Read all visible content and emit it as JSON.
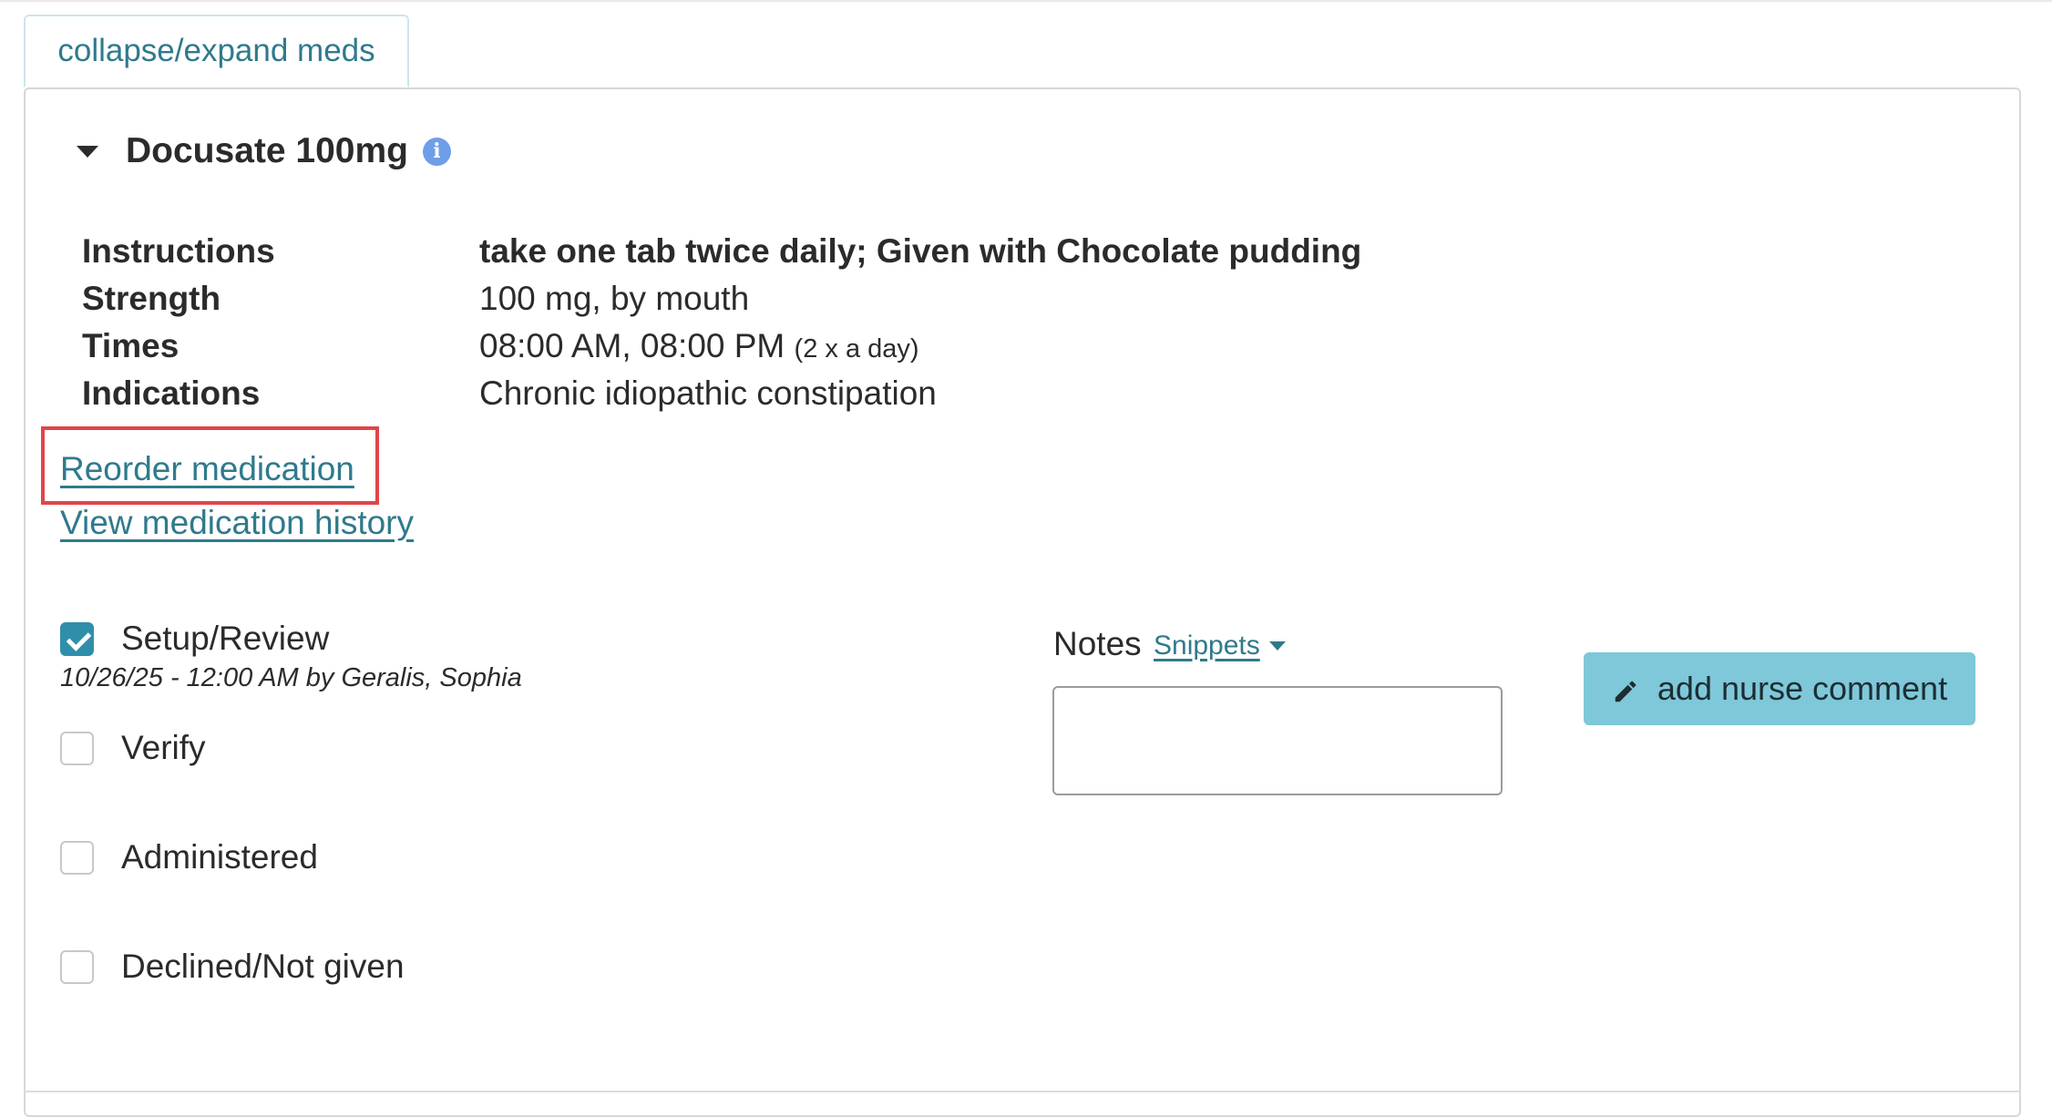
{
  "toolbar": {
    "collapse_label": "collapse/expand meds"
  },
  "medication": {
    "title": "Docusate 100mg",
    "info_icon": "info-circle-icon",
    "details": {
      "instructions_key": "Instructions",
      "instructions_value": "take one tab twice daily; Given with Chocolate pudding",
      "strength_key": "Strength",
      "strength_value": "100 mg, by mouth",
      "times_key": "Times",
      "times_value": "08:00 AM, 08:00 PM",
      "times_freq": "(2 x a day)",
      "indications_key": "Indications",
      "indications_value": "Chronic idiopathic constipation"
    },
    "links": {
      "reorder": "Reorder medication",
      "history": "View medication history"
    }
  },
  "checklist": {
    "setup_label": "Setup/Review",
    "setup_checked": true,
    "setup_meta": "10/26/25 - 12:00 AM by Geralis, Sophia",
    "verify_label": "Verify",
    "administered_label": "Administered",
    "declined_label": "Declined/Not given"
  },
  "notes": {
    "label": "Notes",
    "snippets_label": "Snippets",
    "value": ""
  },
  "nurse_comment": {
    "label": "add nurse comment",
    "icon": "pencil-icon"
  },
  "colors": {
    "link": "#2f7a8c",
    "checkbox_checked": "#2f8faa",
    "nurse_button": "#7ec8d9",
    "highlight": "#e0454a",
    "info_icon": "#6f9ee8"
  }
}
